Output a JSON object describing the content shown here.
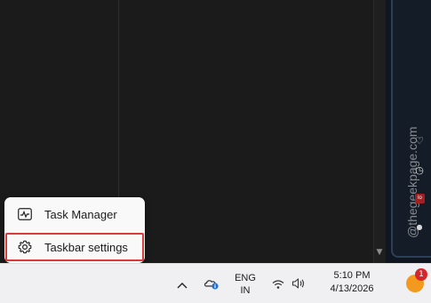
{
  "context_menu": {
    "items": [
      {
        "label": "Task Manager",
        "icon": "task-manager-icon"
      },
      {
        "label": "Taskbar settings",
        "icon": "gear-icon",
        "highlighted": true
      }
    ],
    "highlight_color": "#d93b3b"
  },
  "taskbar": {
    "tray_overflow_icon": "chevron-up-icon",
    "onedrive_icon": "onedrive-icon",
    "language": {
      "line1": "ENG",
      "line2": "IN"
    },
    "wifi_icon": "wifi-icon",
    "volume_icon": "volume-icon",
    "clock": {
      "time": "5:10 PM",
      "date": "4/13/2026"
    },
    "notification": {
      "badge_count": "1",
      "color": "#f39a1e",
      "badge_color": "#d6262b"
    }
  },
  "side_panel": {
    "watermark": "@thegeekpage.com",
    "badge": "lo"
  }
}
